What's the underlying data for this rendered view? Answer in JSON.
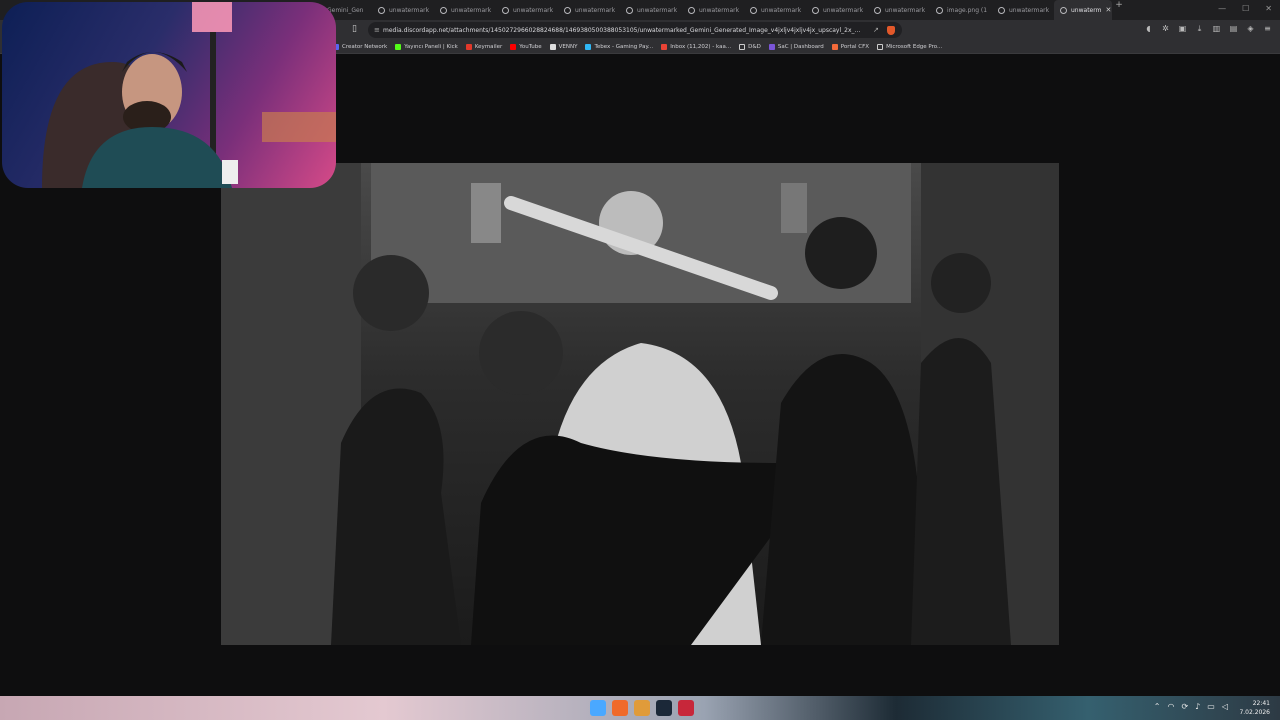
{
  "tabs": [
    {
      "title": "Gemini_Gen"
    },
    {
      "title": "unwatermark"
    },
    {
      "title": "unwatermark"
    },
    {
      "title": "unwatermark"
    },
    {
      "title": "unwatermark"
    },
    {
      "title": "unwatermark"
    },
    {
      "title": "unwatermark"
    },
    {
      "title": "unwatermark"
    },
    {
      "title": "unwatermark"
    },
    {
      "title": "unwatermark"
    },
    {
      "title": "image.png (1"
    },
    {
      "title": "unwatermark"
    },
    {
      "title": "unwaterm"
    }
  ],
  "active_tab_index": 12,
  "address_bar": {
    "url": "media.discordapp.net/attachments/1450272966028824688/1469380500388053105/unwatermarked_Gemini_Generated_Image_v4jxljv4jxljv4jx_upscayl_2x_..."
  },
  "bookmarks": [
    {
      "label": "Creator Network",
      "icon": "creator-network-icon",
      "color": "#5865f2"
    },
    {
      "label": "Yayıncı Paneli | Kick",
      "icon": "kick-icon",
      "color": "#53fc18"
    },
    {
      "label": "Keymailer",
      "icon": "keymailer-icon",
      "color": "#e2382a"
    },
    {
      "label": "YouTube",
      "icon": "youtube-icon",
      "color": "#ff0000"
    },
    {
      "label": "VENNY",
      "icon": "venny-icon",
      "color": "#dddddd"
    },
    {
      "label": "Tebex - Gaming Pay...",
      "icon": "tebex-icon",
      "color": "#2fb7f5"
    },
    {
      "label": "Inbox (11,202) - kaa...",
      "icon": "gmail-icon",
      "color": "#ea4335"
    },
    {
      "label": "D&D",
      "icon": "folder-icon",
      "color": "#cccccc"
    },
    {
      "label": "SaC | Dashboard",
      "icon": "sac-icon",
      "color": "#7a55d8"
    },
    {
      "label": "Portal CFX",
      "icon": "cfx-icon",
      "color": "#f46a3a"
    },
    {
      "label": "Microsoft Edge Pro...",
      "icon": "folder-icon",
      "color": "#cccccc"
    }
  ],
  "taskbar": {
    "time": "22:41",
    "date": "7.02.2026"
  },
  "colors": {
    "brave_shield": "#e2582a",
    "tab_bg": "#1f1f21",
    "toolbar_bg": "#2f2f32"
  }
}
